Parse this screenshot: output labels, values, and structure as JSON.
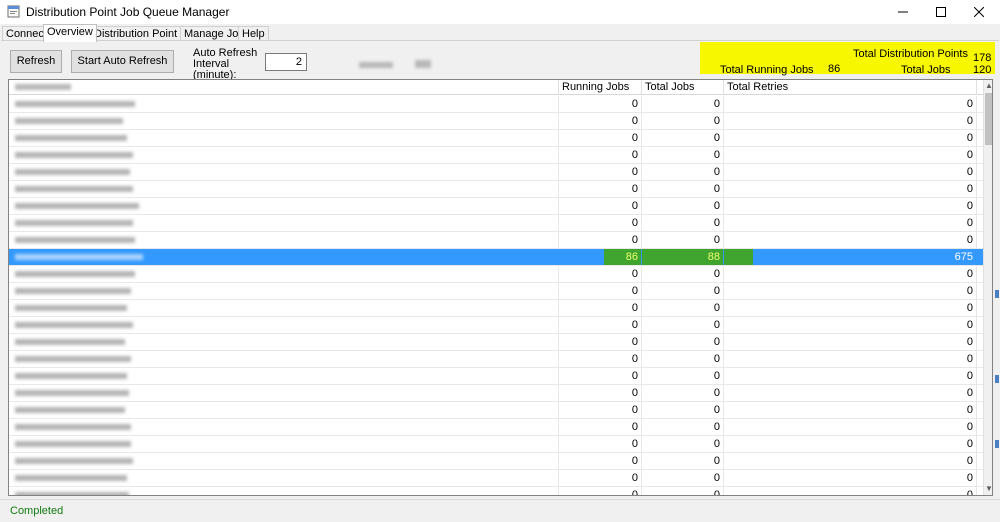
{
  "window": {
    "title": "Distribution Point Job Queue Manager",
    "controls": {
      "minimize": "–",
      "maximize": "☐",
      "close": "✕"
    }
  },
  "tabs": [
    {
      "label": "Connect"
    },
    {
      "label": "Overview",
      "active": true
    },
    {
      "label": "Distribution Point Info"
    },
    {
      "label": "Manage Jobs"
    },
    {
      "label": "Help"
    }
  ],
  "toolbar": {
    "refresh_label": "Refresh",
    "auto_refresh_label": "Start Auto Refresh",
    "interval_label": "Auto Refresh Interval (minute):",
    "interval_value": "2"
  },
  "summary": {
    "total_dp_label": "Total Distribution Points",
    "total_dp_value": "178",
    "running_label": "Total Running Jobs",
    "running_value": "86",
    "total_jobs_label": "Total Jobs",
    "total_jobs_value": "120",
    "highlight_color": "#f7f700"
  },
  "grid": {
    "columns": {
      "name": "",
      "running": "Running Jobs",
      "total": "Total Jobs",
      "retries": "Total Retries"
    },
    "rows": [
      {
        "running": "0",
        "total": "0",
        "retries": "0"
      },
      {
        "running": "0",
        "total": "0",
        "retries": "0"
      },
      {
        "running": "0",
        "total": "0",
        "retries": "0"
      },
      {
        "running": "0",
        "total": "0",
        "retries": "0"
      },
      {
        "running": "0",
        "total": "0",
        "retries": "0"
      },
      {
        "running": "0",
        "total": "0",
        "retries": "0"
      },
      {
        "running": "0",
        "total": "0",
        "retries": "0"
      },
      {
        "running": "0",
        "total": "0",
        "retries": "0"
      },
      {
        "running": "0",
        "total": "0",
        "retries": "0"
      },
      {
        "running": "86",
        "total": "88",
        "retries": "675",
        "selected": true
      },
      {
        "running": "0",
        "total": "0",
        "retries": "0"
      },
      {
        "running": "0",
        "total": "0",
        "retries": "0"
      },
      {
        "running": "0",
        "total": "0",
        "retries": "0"
      },
      {
        "running": "0",
        "total": "0",
        "retries": "0"
      },
      {
        "running": "0",
        "total": "0",
        "retries": "0"
      },
      {
        "running": "0",
        "total": "0",
        "retries": "0"
      },
      {
        "running": "0",
        "total": "0",
        "retries": "0"
      },
      {
        "running": "0",
        "total": "0",
        "retries": "0"
      },
      {
        "running": "0",
        "total": "0",
        "retries": "0"
      },
      {
        "running": "0",
        "total": "0",
        "retries": "0"
      },
      {
        "running": "0",
        "total": "0",
        "retries": "0"
      },
      {
        "running": "0",
        "total": "0",
        "retries": "0"
      },
      {
        "running": "0",
        "total": "0",
        "retries": "0"
      },
      {
        "running": "0",
        "total": "0",
        "retries": "0"
      }
    ],
    "selection_color": "#3399ff",
    "active_cell_color": "#3fa52e"
  },
  "status": {
    "text": "Completed",
    "color": "#117a11"
  },
  "icons": {
    "app": "app-window-icon",
    "scroll_up": "chevron-up-icon",
    "scroll_down": "chevron-down-icon"
  }
}
